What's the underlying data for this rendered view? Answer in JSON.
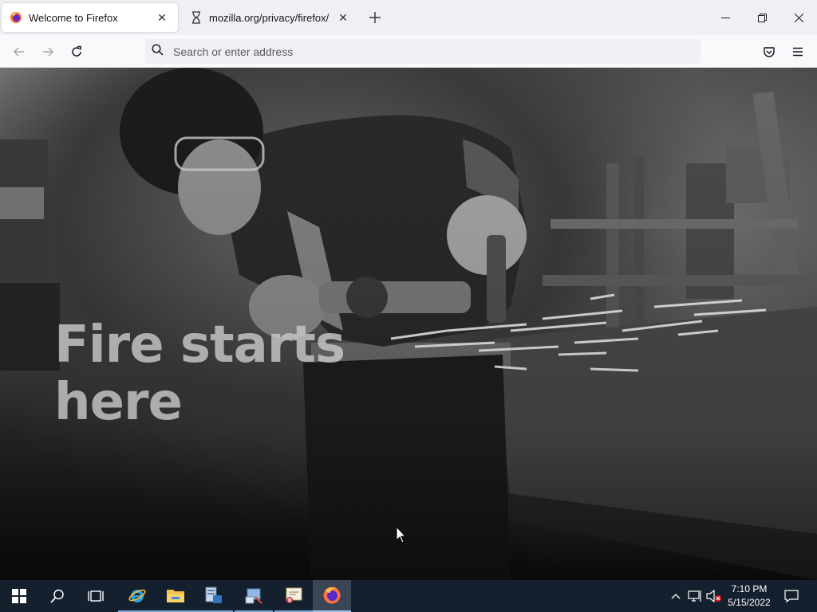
{
  "tabs": [
    {
      "title": "Welcome to Firefox",
      "icon": "firefox-icon",
      "active": true
    },
    {
      "title": "mozilla.org/privacy/firefox/",
      "icon": "hourglass-icon",
      "active": false
    }
  ],
  "window_controls": [
    "minimize",
    "restore",
    "close"
  ],
  "navbar": {
    "url_placeholder": "Search or enter address",
    "url_value": ""
  },
  "hero": {
    "line1": "Fire starts",
    "line2": "here"
  },
  "taskbar": {
    "apps": [
      "start-icon",
      "search-icon",
      "task-view-icon",
      "internet-explorer-icon",
      "file-explorer-icon",
      "server-manager-icon",
      "control-panel-icon",
      "certificate-icon",
      "firefox-icon"
    ],
    "clock": {
      "time": "7:10 PM",
      "date": "5/15/2022"
    }
  },
  "colors": {
    "tabstrip_bg": "#f0f0f4",
    "navbar_bg": "#f9f9fb",
    "taskbar_bg": "#15202e"
  }
}
